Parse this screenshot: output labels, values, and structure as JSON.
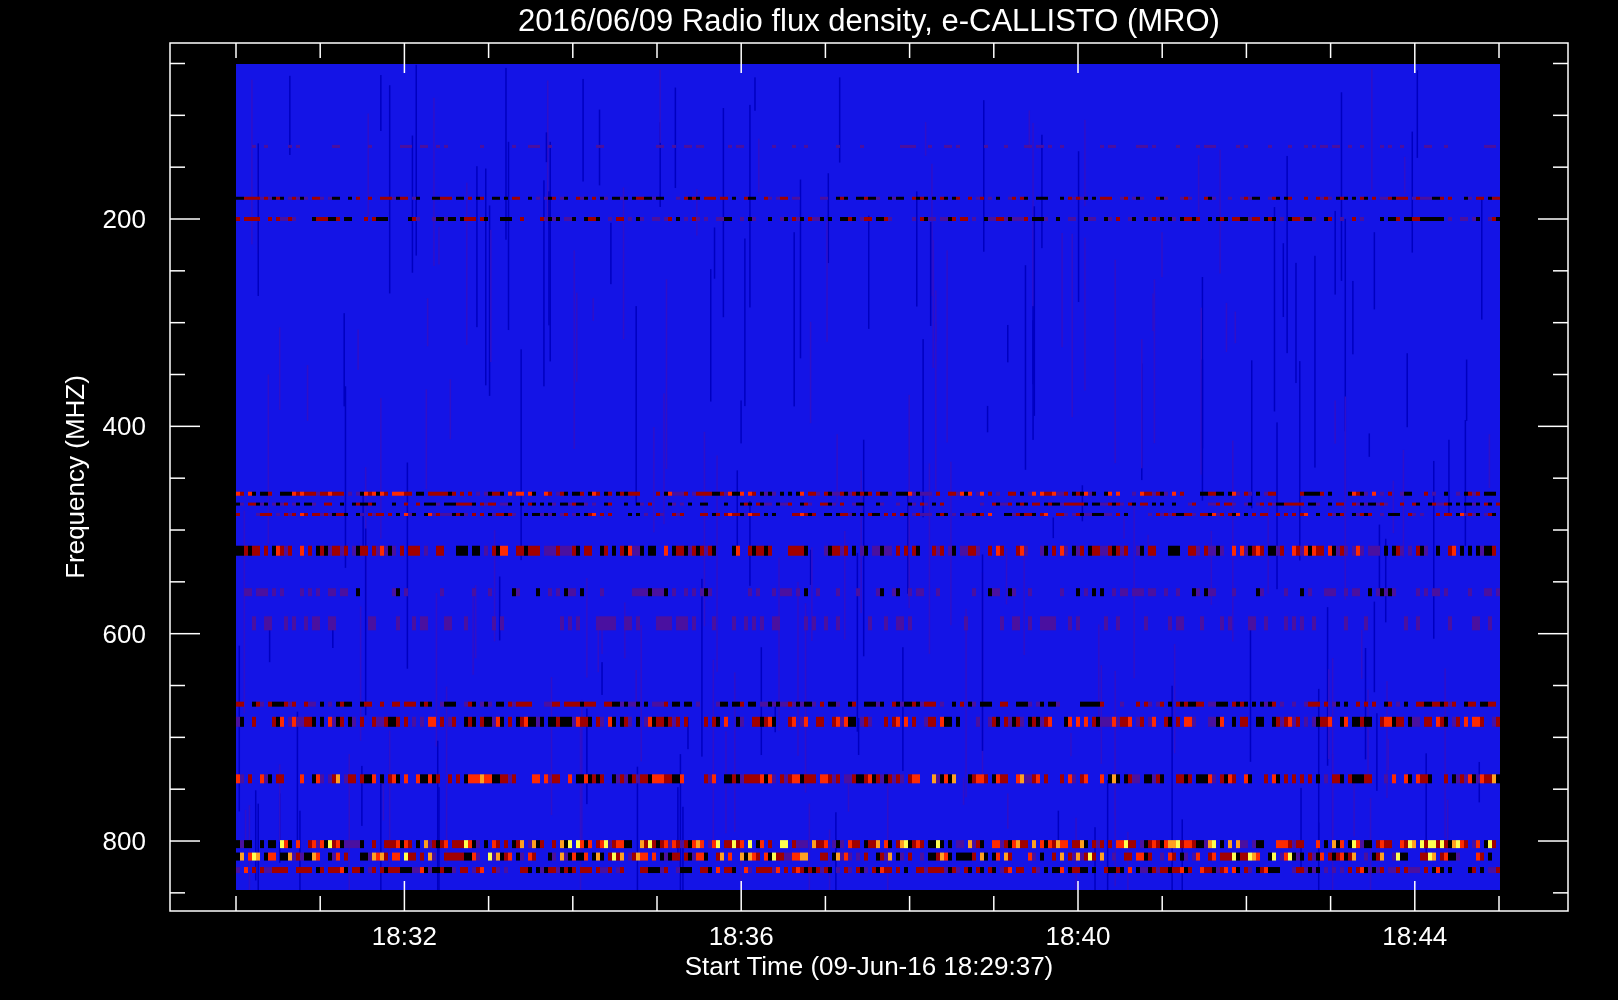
{
  "title": "2016/06/09  Radio flux density, e-CALLISTO (MRO)",
  "y_axis": {
    "label": "Frequency (MHZ)",
    "ticks": [
      "200",
      "400",
      "600",
      "800"
    ]
  },
  "x_axis": {
    "label": "Start Time (09-Jun-16 18:29:37)",
    "ticks": [
      "18:32",
      "18:36",
      "18:40",
      "18:44"
    ]
  }
}
